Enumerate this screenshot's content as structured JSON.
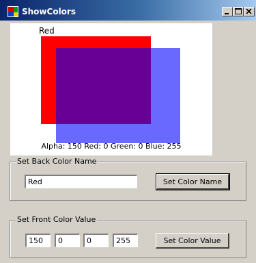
{
  "window": {
    "title": "ShowColors",
    "controls": [
      "minimize-icon",
      "maximize-icon",
      "close-icon"
    ]
  },
  "canvas": {
    "back_color_name": "Red",
    "back_color_hex": "#ff0000",
    "front_color_hex": "#0000ff",
    "front_alpha": 150,
    "info_text": "Alpha: 150 Red: 0 Green: 0 Blue: 255"
  },
  "back_group": {
    "title": "Set Back Color Name",
    "name_value": "Red",
    "button_label": "Set Color Name"
  },
  "front_group": {
    "title": "Set Front Color Value",
    "alpha_value": "150",
    "red_value": "0",
    "green_value": "0",
    "blue_value": "255",
    "button_label": "Set Color Value"
  }
}
